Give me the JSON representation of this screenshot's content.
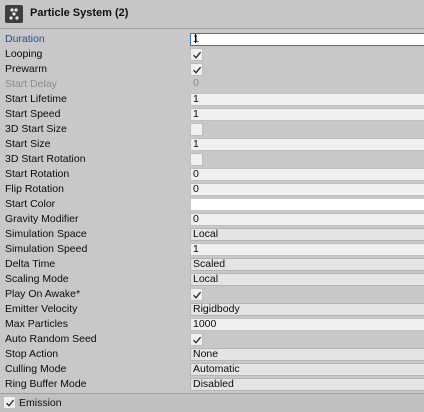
{
  "header": {
    "title": "Particle System (2)",
    "icon": "particle-system-icon"
  },
  "properties": [
    {
      "name": "duration",
      "label": "Duration",
      "kind": "text",
      "value": "1",
      "state": "focused"
    },
    {
      "name": "looping",
      "label": "Looping",
      "kind": "checkbox",
      "checked": true
    },
    {
      "name": "prewarm",
      "label": "Prewarm",
      "kind": "checkbox",
      "checked": true
    },
    {
      "name": "start-delay",
      "label": "Start Delay",
      "kind": "text",
      "value": "0",
      "state": "disabled"
    },
    {
      "name": "start-lifetime",
      "label": "Start Lifetime",
      "kind": "text",
      "value": "1"
    },
    {
      "name": "start-speed",
      "label": "Start Speed",
      "kind": "text",
      "value": "1"
    },
    {
      "name": "3d-start-size",
      "label": "3D Start Size",
      "kind": "checkbox",
      "checked": false
    },
    {
      "name": "start-size",
      "label": "Start Size",
      "kind": "text",
      "value": "1"
    },
    {
      "name": "3d-start-rotation",
      "label": "3D Start Rotation",
      "kind": "checkbox",
      "checked": false
    },
    {
      "name": "start-rotation",
      "label": "Start Rotation",
      "kind": "text",
      "value": "0"
    },
    {
      "name": "flip-rotation",
      "label": "Flip Rotation",
      "kind": "text",
      "value": "0"
    },
    {
      "name": "start-color",
      "label": "Start Color",
      "kind": "color",
      "value": "#ffffff"
    },
    {
      "name": "gravity-modifier",
      "label": "Gravity Modifier",
      "kind": "text",
      "value": "0"
    },
    {
      "name": "simulation-space",
      "label": "Simulation Space",
      "kind": "dropdown",
      "value": "Local"
    },
    {
      "name": "simulation-speed",
      "label": "Simulation Speed",
      "kind": "text",
      "value": "1"
    },
    {
      "name": "delta-time",
      "label": "Delta Time",
      "kind": "dropdown",
      "value": "Scaled"
    },
    {
      "name": "scaling-mode",
      "label": "Scaling Mode",
      "kind": "dropdown",
      "value": "Local"
    },
    {
      "name": "play-on-awake",
      "label": "Play On Awake*",
      "kind": "checkbox",
      "checked": true
    },
    {
      "name": "emitter-velocity",
      "label": "Emitter Velocity",
      "kind": "dropdown",
      "value": "Rigidbody"
    },
    {
      "name": "max-particles",
      "label": "Max Particles",
      "kind": "text",
      "value": "1000"
    },
    {
      "name": "auto-random-seed",
      "label": "Auto Random Seed",
      "kind": "checkbox",
      "checked": true
    },
    {
      "name": "stop-action",
      "label": "Stop Action",
      "kind": "dropdown",
      "value": "None"
    },
    {
      "name": "culling-mode",
      "label": "Culling Mode",
      "kind": "dropdown",
      "value": "Automatic"
    },
    {
      "name": "ring-buffer-mode",
      "label": "Ring Buffer Mode",
      "kind": "dropdown",
      "value": "Disabled"
    }
  ],
  "footer": {
    "label": "Emission",
    "checked": true
  },
  "colors": {
    "panel": "#c8c8c8",
    "active_label": "#1f4f92",
    "disabled_text": "#8a8a8a",
    "focus_border": "#3a72b0"
  }
}
